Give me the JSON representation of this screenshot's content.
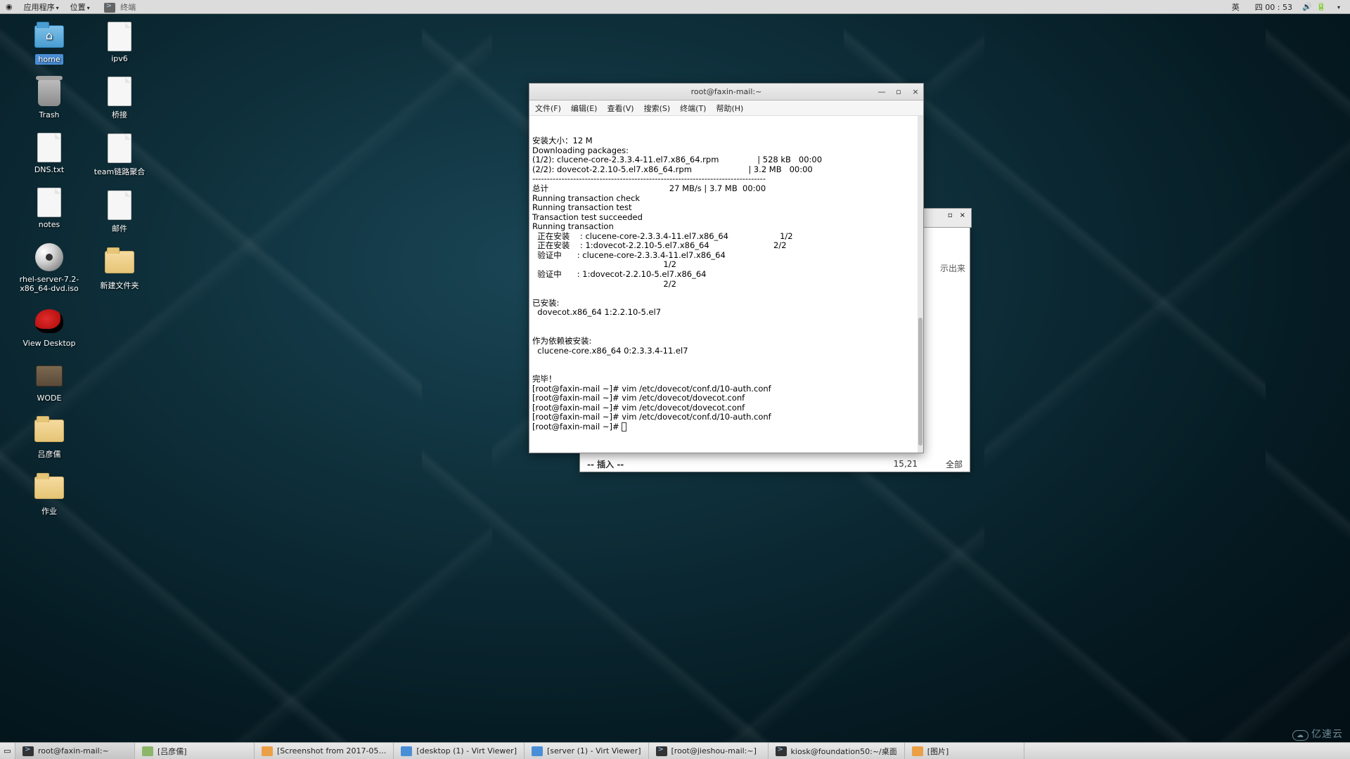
{
  "top_panel": {
    "apps": "应用程序",
    "places": "位置",
    "running_app": "终端",
    "ime": "英",
    "datetime": "四 00 : 53"
  },
  "desktop": {
    "col1": [
      {
        "icon": "folder-home",
        "label": "home",
        "selected": true
      },
      {
        "icon": "trash",
        "label": "Trash"
      },
      {
        "icon": "file",
        "label": "DNS.txt"
      },
      {
        "icon": "file",
        "label": "notes"
      },
      {
        "icon": "disc",
        "label": "rhel-server-7.2-x86_64-dvd.iso"
      },
      {
        "icon": "redhat",
        "label": "View Desktop"
      },
      {
        "icon": "drive",
        "label": "WODE"
      },
      {
        "icon": "folder",
        "label": "吕彦儒"
      },
      {
        "icon": "folder",
        "label": "作业"
      }
    ],
    "col2": [
      {
        "icon": "file",
        "label": "ipv6"
      },
      {
        "icon": "file",
        "label": "桥接"
      },
      {
        "icon": "file",
        "label": "team链路聚合"
      },
      {
        "icon": "file",
        "label": "邮件"
      },
      {
        "icon": "folder",
        "label": "新建文件夹"
      }
    ]
  },
  "terminal": {
    "title": "root@faxin-mail:~",
    "menu": [
      "文件(F)",
      "编辑(E)",
      "查看(V)",
      "搜索(S)",
      "终端(T)",
      "帮助(H)"
    ],
    "lines": [
      "安装大小：12 M",
      "Downloading packages:",
      "(1/2): clucene-core-2.3.3.4-11.el7.x86_64.rpm               | 528 kB   00:00",
      "(2/2): dovecot-2.2.10-5.el7.x86_64.rpm                      | 3.2 MB   00:00",
      "--------------------------------------------------------------------------------",
      "总计                                               27 MB/s | 3.7 MB  00:00",
      "Running transaction check",
      "Running transaction test",
      "Transaction test succeeded",
      "Running transaction",
      "  正在安装    : clucene-core-2.3.3.4-11.el7.x86_64                    1/2",
      "  正在安装    : 1:dovecot-2.2.10-5.el7.x86_64                         2/2",
      "  验证中      : clucene-core-2.3.3.4-11.el7.x86_64",
      "                                                   1/2",
      "  验证中      : 1:dovecot-2.2.10-5.el7.x86_64",
      "                                                   2/2",
      "",
      "已安装:",
      "  dovecot.x86_64 1:2.2.10-5.el7",
      "",
      "",
      "作为依赖被安装:",
      "  clucene-core.x86_64 0:2.3.3.4-11.el7",
      "",
      "",
      "完毕！",
      "[root@faxin-mail ~]# vim /etc/dovecot/conf.d/10-auth.conf",
      "[root@faxin-mail ~]# vim /etc/dovecot/dovecot.conf",
      "[root@faxin-mail ~]# vim /etc/dovecot/dovecot.conf",
      "[root@faxin-mail ~]# vim /etc/dovecot/conf.d/10-auth.conf",
      "[root@faxin-mail ~]# "
    ]
  },
  "editor_peek": {
    "visible_text": "示出来",
    "mode": "-- 插入 --",
    "pos": "15,21",
    "percent": "全部"
  },
  "taskbar": {
    "items": [
      {
        "icon": "term",
        "label": "root@faxin-mail:~",
        "active": true
      },
      {
        "icon": "edit",
        "label": "[吕彦儒]"
      },
      {
        "icon": "img",
        "label": "[Screenshot from 2017-05…"
      },
      {
        "icon": "vm",
        "label": "[desktop (1) - Virt Viewer]"
      },
      {
        "icon": "vm",
        "label": "[server (1) - Virt Viewer]"
      },
      {
        "icon": "term",
        "label": "[root@jieshou-mail:~]"
      },
      {
        "icon": "term",
        "label": "kiosk@foundation50:~/桌面"
      },
      {
        "icon": "img",
        "label": "[图片]"
      }
    ]
  },
  "logo": "亿速云"
}
